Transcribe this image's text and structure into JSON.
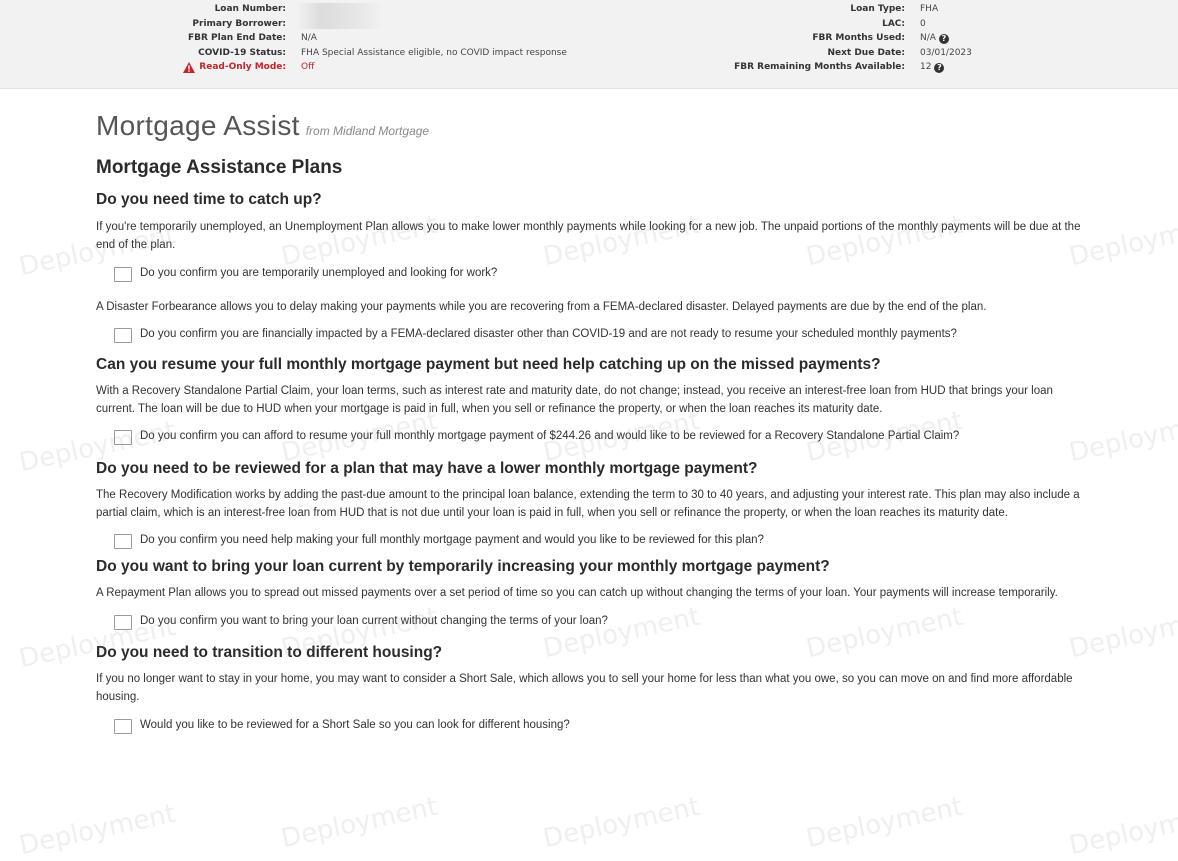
{
  "loan_info": {
    "left": [
      {
        "label": "Loan Number:",
        "value": ""
      },
      {
        "label": "Primary Borrower:",
        "value": ""
      },
      {
        "label": "FBR Plan End Date:",
        "value": "N/A"
      },
      {
        "label": "COVID-19 Status:",
        "value": "FHA Special Assistance eligible, no COVID impact response"
      },
      {
        "label": "Read-Only Mode:",
        "value": "Off"
      }
    ],
    "right": [
      {
        "label": "Loan Type:",
        "value": "FHA"
      },
      {
        "label": "LAC:",
        "value": "0"
      },
      {
        "label": "FBR Months Used:",
        "value": "N/A"
      },
      {
        "label": "Next Due Date:",
        "value": "03/01/2023"
      },
      {
        "label": "FBR Remaining Months Available:",
        "value": "12"
      }
    ],
    "help_glyph": "?",
    "warning_color": "#c0262d"
  },
  "header": {
    "title": "Mortgage Assist",
    "subtitle": "from Midland Mortgage"
  },
  "section_title": "Mortgage Assistance Plans",
  "plans": [
    {
      "heading": "Do you need time to catch up?",
      "paragraph": "If you're temporarily unemployed, an Unemployment Plan allows you to make lower monthly payments while looking for a new job. The unpaid portions of the monthly payments will be due at the end of the plan.",
      "question": "Do you confirm you are temporarily unemployed and looking for work?"
    },
    {
      "paragraph": "A Disaster Forbearance allows you to delay making your payments while you are recovering from a FEMA-declared disaster. Delayed payments are due by the end of the plan.",
      "question": "Do you confirm you are financially impacted by a FEMA-declared disaster other than COVID-19 and are not ready to resume your scheduled monthly payments?"
    },
    {
      "heading": "Can you resume your full monthly mortgage payment but need help catching up on the missed payments?",
      "paragraph": "With a Recovery Standalone Partial Claim, your loan terms, such as interest rate and maturity date, do not change; instead, you receive an interest-free loan from HUD that brings your loan current. The loan will be due to HUD when your mortgage is paid in full, when you sell or refinance the property, or when the loan reaches its maturity date.",
      "question": "Do you confirm you can afford to resume your full monthly mortgage payment of $244.26 and would like to be reviewed for a Recovery Standalone Partial Claim?"
    },
    {
      "heading": "Do you need to be reviewed for a plan that may have a lower monthly mortgage payment?",
      "paragraph": "The Recovery Modification works by adding the past-due amount to the principal loan balance, extending the term to 30 to 40 years, and adjusting your interest rate. This plan may also include a partial claim, which is an interest-free loan from HUD that is not due until your loan is paid in full, when you sell or refinance the property, or when the loan reaches its maturity date.",
      "question": "Do you confirm you need help making your full monthly mortgage payment and would you like to be reviewed for this plan?"
    },
    {
      "heading": "Do you want to bring your loan current by temporarily increasing your monthly mortgage payment?",
      "paragraph": "A Repayment Plan allows you to spread out missed payments over a set period of time so you can catch up without changing the terms of your loan. Your payments will increase temporarily.",
      "question": "Do you confirm you want to bring your loan current without changing the terms of your loan?"
    },
    {
      "heading": "Do you need to transition to different housing?",
      "paragraph": "If you no longer want to stay in your home, you may want to consider a Short Sale, which allows you to sell your home for less than what you owe, so you can move on and find more affordable housing.",
      "question": "Would you like to be reviewed for a Short Sale so you can look for different housing?"
    }
  ],
  "watermark_text": "Deployment"
}
